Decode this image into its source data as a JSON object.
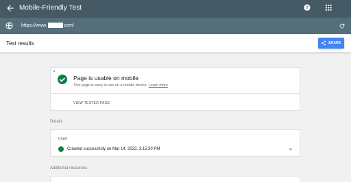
{
  "app": {
    "title": "Mobile-Friendly Test"
  },
  "url": {
    "prefix": "https://www.",
    "suffix": "com/"
  },
  "results": {
    "title": "Test results",
    "share_label": "SHARE"
  },
  "summary": {
    "headline": "Page is usable on mobile",
    "description": "This page is easy to use on a mobile device.",
    "learn_more": "Learn more",
    "view_tested_page": "VIEW TESTED PAGE"
  },
  "details": {
    "label": "Details",
    "crawl_label": "Crawl",
    "crawl_status": "Crawled successfully on Mar 14, 2023, 3:15:30 PM"
  },
  "additional": {
    "label": "Additional resources"
  },
  "colors": {
    "appbar": "#455a64",
    "urlbar": "#546e7a",
    "share": "#4285f4",
    "success": "#0b8043"
  },
  "icons": [
    "back-arrow-icon",
    "help-icon",
    "apps-grid-icon",
    "globe-icon",
    "refresh-icon",
    "share-icon",
    "check-circle-icon",
    "chevron-down-icon"
  ]
}
